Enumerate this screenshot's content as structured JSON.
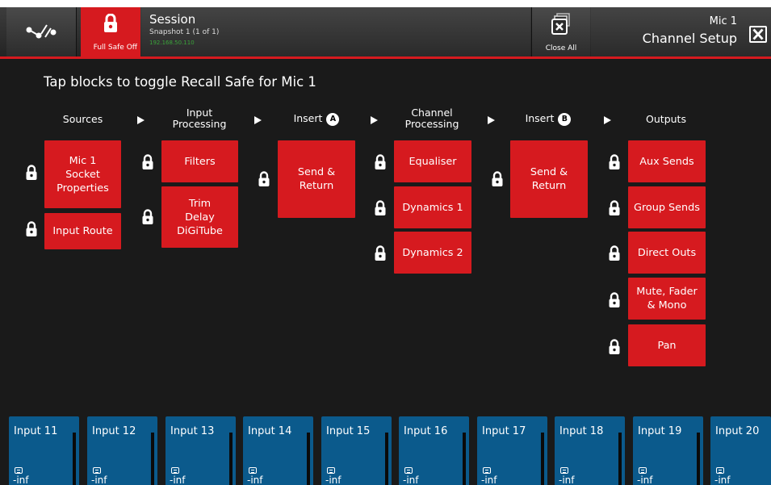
{
  "header": {
    "safe_label": "Full Safe Off",
    "session_title": "Session",
    "session_subtitle": "Snapshot 1 (1 of 1)",
    "session_ip": "192.168.50.110",
    "close_all_label": "Close All",
    "channel_name": "Mic 1",
    "channel_title": "Channel Setup",
    "icons": [
      "network-icon",
      "lock-icon",
      "close-all-icon",
      "close-icon"
    ],
    "accent_color": "#d61a1f"
  },
  "instructions": "Tap blocks to toggle Recall Safe for Mic 1",
  "columns": {
    "sources": {
      "title": "Sources"
    },
    "input_processing": {
      "title_line1": "Input",
      "title_line2": "Processing"
    },
    "insert_a": {
      "title": "Insert",
      "badge": "A"
    },
    "channel_processing": {
      "title_line1": "Channel",
      "title_line2": "Processing"
    },
    "insert_b": {
      "title": "Insert",
      "badge": "B"
    },
    "outputs": {
      "title": "Outputs"
    }
  },
  "blocks": {
    "socket": {
      "line1": "Mic 1",
      "line2": "Socket",
      "line3": "Properties"
    },
    "input_route": "Input Route",
    "filters": "Filters",
    "trim": {
      "line1": "Trim",
      "line2": "Delay",
      "line3": "DiGiTube"
    },
    "insert_a_send": {
      "line1": "Send &",
      "line2": "Return"
    },
    "equaliser": "Equaliser",
    "dynamics1": "Dynamics 1",
    "dynamics2": "Dynamics 2",
    "insert_b_send": {
      "line1": "Send &",
      "line2": "Return"
    },
    "aux_sends": "Aux Sends",
    "group_sends": "Group Sends",
    "direct_outs": "Direct Outs",
    "mute_fader": {
      "line1": "Mute, Fader",
      "line2": "& Mono"
    },
    "pan": "Pan"
  },
  "strips": [
    {
      "name": "Input 11",
      "value": "-inf"
    },
    {
      "name": "Input 12",
      "value": "-inf"
    },
    {
      "name": "Input 13",
      "value": "-inf"
    },
    {
      "name": "Input 14",
      "value": "-inf"
    },
    {
      "name": "Input 15",
      "value": "-inf"
    },
    {
      "name": "Input 16",
      "value": "-inf"
    },
    {
      "name": "Input 17",
      "value": "-inf"
    },
    {
      "name": "Input 18",
      "value": "-inf"
    },
    {
      "name": "Input 19",
      "value": "-inf"
    },
    {
      "name": "Input 20",
      "value": "-inf"
    }
  ],
  "colors": {
    "block": "#d61a1f",
    "strip": "#0b5a8c",
    "background": "#1a1a1a",
    "ip_text": "#3aa23a"
  }
}
